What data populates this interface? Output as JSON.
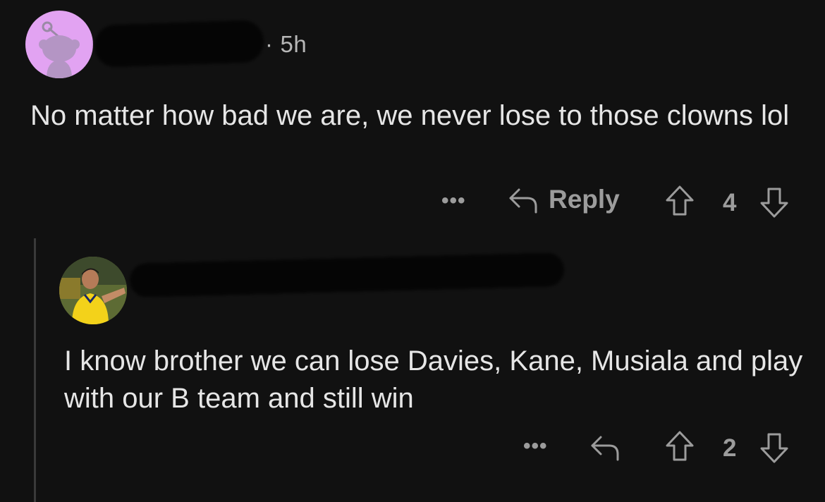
{
  "comment": {
    "username": "",
    "separator": "·",
    "time": "5h",
    "text": "No matter how bad we are, we never lose to those clowns lol",
    "actions": {
      "more_label": "•••",
      "reply_label": "Reply",
      "score": "4"
    }
  },
  "reply": {
    "username": "",
    "time": "",
    "text": "I know brother we can lose Davies, Kane, Musiala and play with our B team and still win",
    "actions": {
      "more_label": "•••",
      "score": "2"
    }
  },
  "colors": {
    "background": "#111111",
    "text": "#e6e6e6",
    "muted": "#9c9c9c",
    "snoo_avatar_bg": "#e2a3f2",
    "thread_line": "#3a3a3a",
    "jersey_yellow": "#f3d21a"
  },
  "icons": {
    "avatar1": "snoo-avatar-icon",
    "reply": "reply-arrow-icon",
    "upvote": "upvote-arrow-icon",
    "downvote": "downvote-arrow-icon"
  }
}
